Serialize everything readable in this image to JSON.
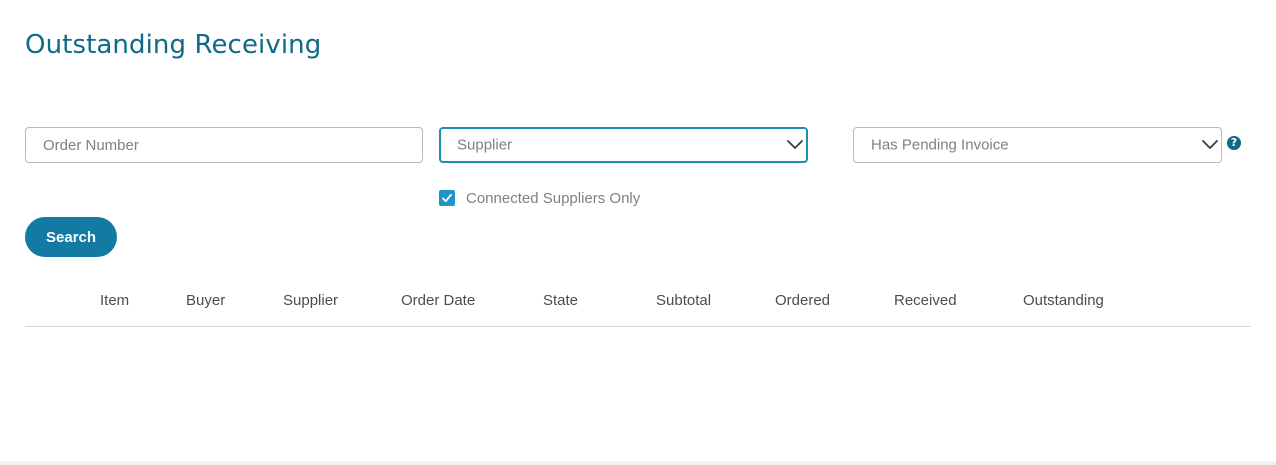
{
  "page": {
    "title": "Outstanding Receiving"
  },
  "filters": {
    "order_number": {
      "placeholder": "Order Number",
      "value": ""
    },
    "supplier": {
      "selected": "Supplier"
    },
    "has_pending_invoice": {
      "selected": "Has Pending Invoice"
    },
    "help_icon_glyph": "?",
    "connected_suppliers_only": {
      "label": "Connected Suppliers Only",
      "checked": true
    }
  },
  "actions": {
    "search_label": "Search"
  },
  "table": {
    "columns": [
      "Item",
      "Buyer",
      "Supplier",
      "Order Date",
      "State",
      "Subtotal",
      "Ordered",
      "Received",
      "Outstanding"
    ],
    "rows": []
  },
  "colors": {
    "title": "#0e6a88",
    "accent": "#127aa3",
    "focus_border": "#1c8fb3",
    "checkbox": "#1a96cc"
  },
  "icons": {
    "dropdown": "chevron-down-icon",
    "help": "question-circle-icon",
    "check": "checkmark-icon"
  }
}
